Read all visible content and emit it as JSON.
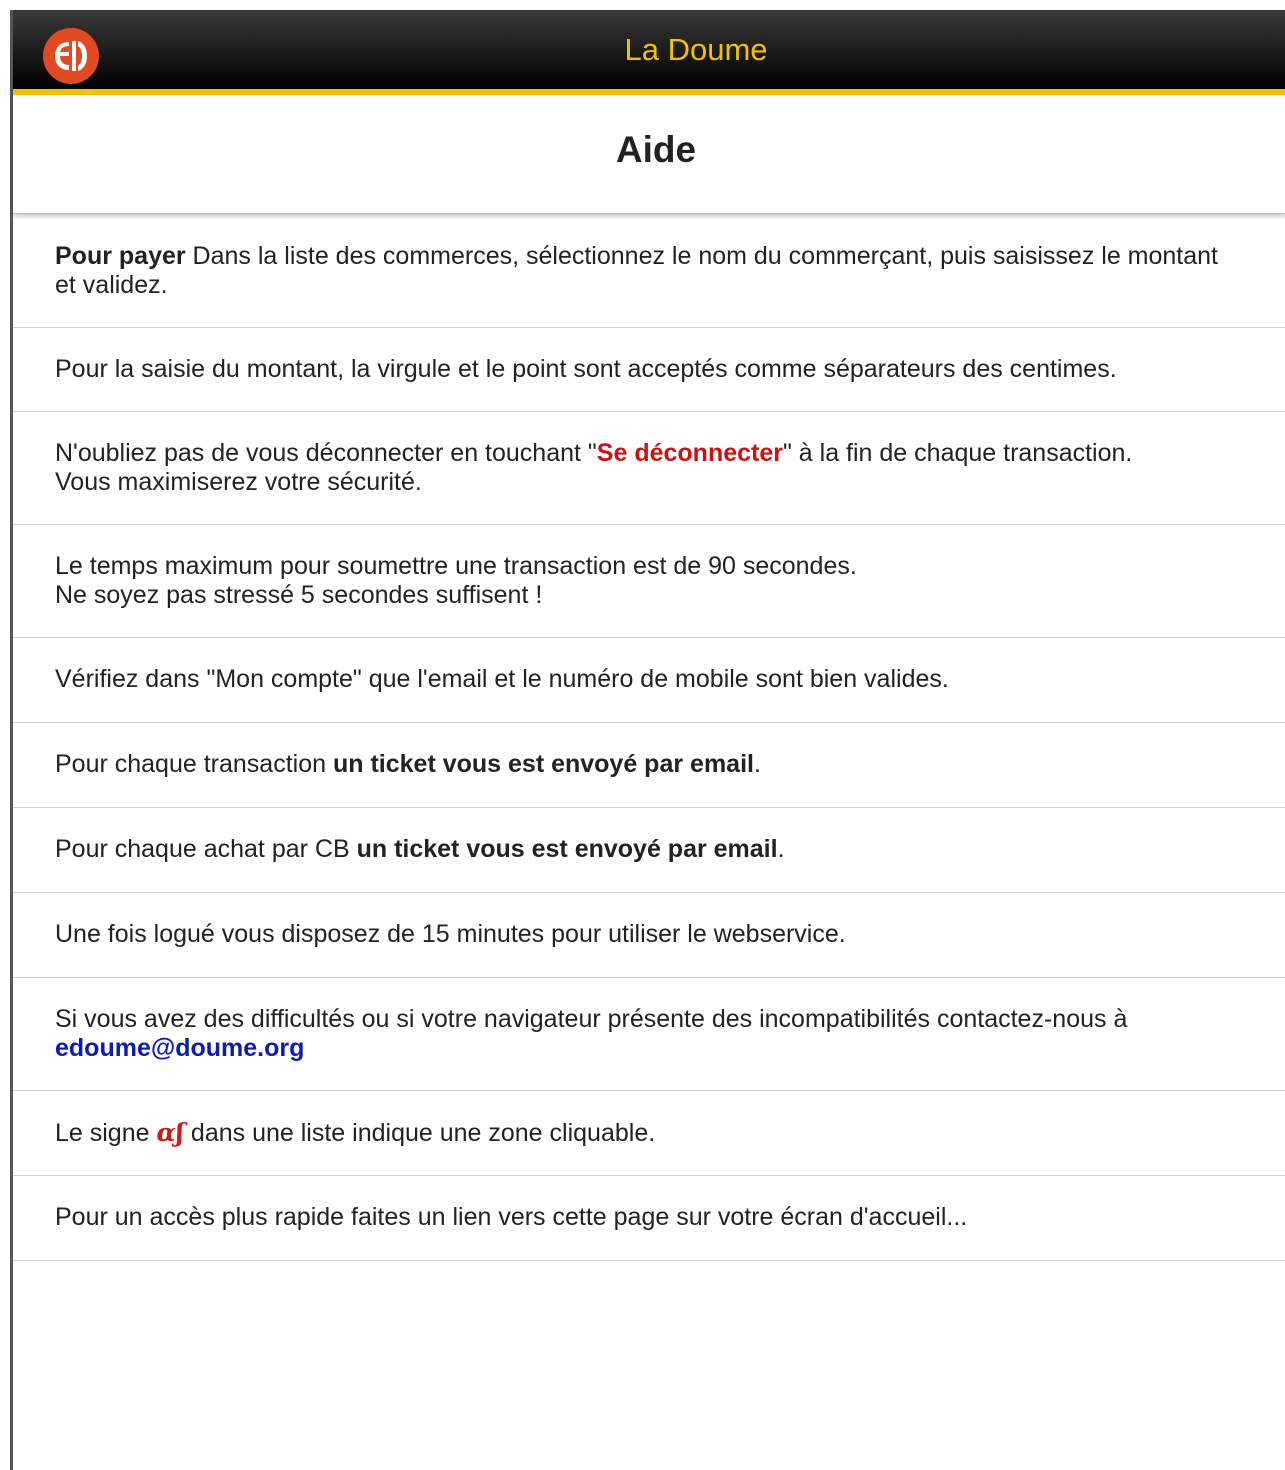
{
  "header": {
    "title": "La Doume",
    "logo_icon": "doume-logo-icon",
    "logo_text": "eD",
    "accent_color": "#f2c200",
    "logo_color": "#e24a24"
  },
  "page": {
    "title": "Aide"
  },
  "items": [
    {
      "parts": [
        "Pour payer",
        " Dans la liste des commerces, sélectionnez le nom du commerçant, puis saisissez le montant et validez."
      ]
    },
    {
      "text": "Pour la saisie du montant, la virgule et le point sont acceptés comme séparateurs des centimes."
    },
    {
      "parts": [
        "N'oubliez pas de vous déconnecter en touchant \"",
        "Se déconnecter",
        "\" à la fin de chaque transaction.",
        "Vous maximiserez votre sécurité."
      ]
    },
    {
      "lines": [
        "Le temps maximum pour soumettre une transaction est de 90 secondes.",
        "Ne soyez pas stressé 5 secondes suffisent !"
      ]
    },
    {
      "text": "Vérifiez dans \"Mon compte\" que l'email et le numéro de mobile sont bien valides."
    },
    {
      "parts": [
        "Pour chaque transaction ",
        "un ticket vous est envoyé par email",
        "."
      ]
    },
    {
      "parts": [
        "Pour chaque achat par CB ",
        "un ticket vous est envoyé par email",
        "."
      ]
    },
    {
      "text": "Une fois logué vous disposez de 15 minutes pour utiliser le webservice."
    },
    {
      "parts": [
        "Si vous avez des difficultés ou si votre navigateur présente des incompatibilités contactez-nous à",
        "edoume@doume.org"
      ]
    },
    {
      "parts": [
        "Le signe ",
        "ɑʃ",
        " dans une liste indique une zone cliquable."
      ],
      "icon": "clickable-sign-icon"
    },
    {
      "text": "Pour un accès plus rapide faites un lien vers cette page sur votre écran d'accueil..."
    }
  ],
  "colors": {
    "link": "#0c1bb0",
    "warning": "#cc1111"
  }
}
